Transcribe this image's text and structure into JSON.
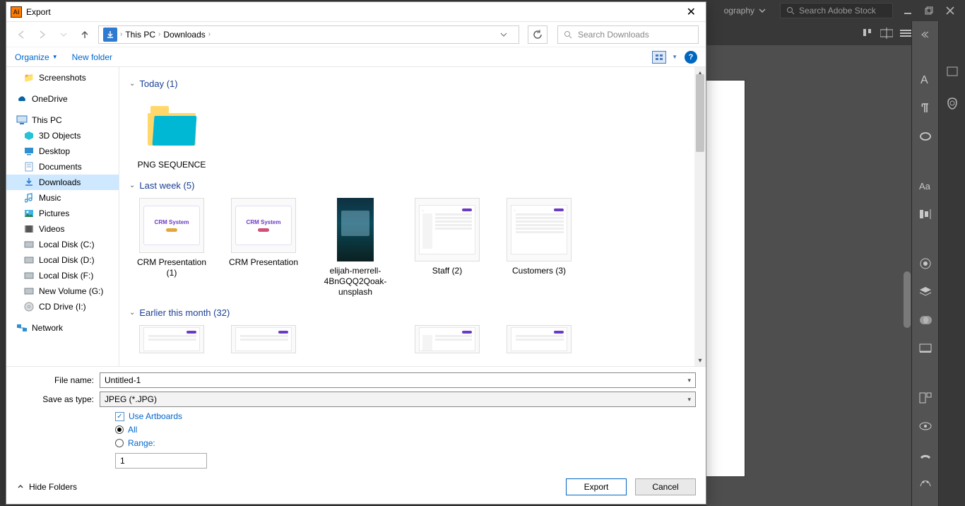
{
  "app": {
    "topbar_label": "ography",
    "search_placeholder": "Search Adobe Stock"
  },
  "dialog": {
    "title": "Export",
    "breadcrumb": {
      "root": "This PC",
      "folder": "Downloads"
    },
    "search_placeholder": "Search Downloads",
    "toolbar": {
      "organize": "Organize",
      "new_folder": "New folder"
    },
    "tree": {
      "quick": [
        {
          "label": "Screenshots",
          "icon": "folder"
        }
      ],
      "onedrive": "OneDrive",
      "thispc": "This PC",
      "pc_items": [
        {
          "label": "3D Objects",
          "icon": "3d"
        },
        {
          "label": "Desktop",
          "icon": "desktop"
        },
        {
          "label": "Documents",
          "icon": "docs"
        },
        {
          "label": "Downloads",
          "icon": "downloads",
          "selected": true
        },
        {
          "label": "Music",
          "icon": "music"
        },
        {
          "label": "Pictures",
          "icon": "pictures"
        },
        {
          "label": "Videos",
          "icon": "videos"
        },
        {
          "label": "Local Disk (C:)",
          "icon": "disk"
        },
        {
          "label": "Local Disk (D:)",
          "icon": "disk"
        },
        {
          "label": "Local Disk (F:)",
          "icon": "disk"
        },
        {
          "label": "New Volume (G:)",
          "icon": "disk"
        },
        {
          "label": "CD Drive (I:)",
          "icon": "cd"
        }
      ],
      "network": "Network"
    },
    "groups": {
      "g1": "Today (1)",
      "g2": "Last week (5)",
      "g3": "Earlier this month (32)"
    },
    "items": {
      "today": [
        {
          "label": "PNG SEQUENCE"
        }
      ],
      "lastweek": [
        {
          "label": "CRM Presentation (1)"
        },
        {
          "label": "CRM Presentation"
        },
        {
          "label": "elijah-merrell-4BnGQQ2Qoak-unsplash"
        },
        {
          "label": "Staff (2)"
        },
        {
          "label": "Customers (3)"
        }
      ]
    },
    "form": {
      "filename_label": "File name:",
      "filename_value": "Untitled-1",
      "saveas_label": "Save as type:",
      "saveas_value": "JPEG (*.JPG)",
      "use_artboards": "Use Artboards",
      "all": "All",
      "range": "Range:",
      "range_value": "1"
    },
    "footer": {
      "hide_folders": "Hide Folders",
      "export": "Export",
      "cancel": "Cancel"
    }
  }
}
